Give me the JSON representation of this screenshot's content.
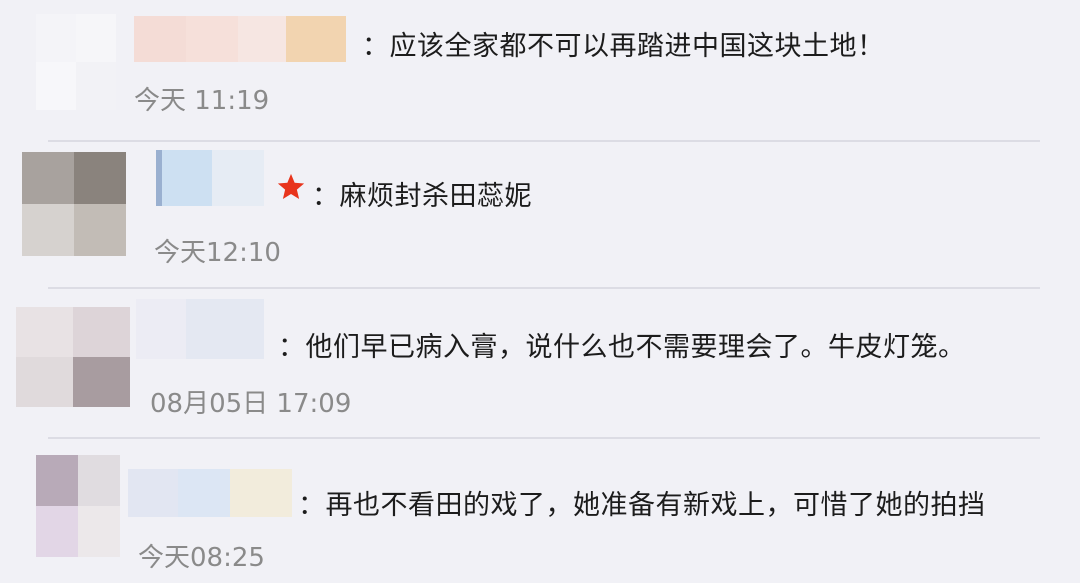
{
  "comments": [
    {
      "text": "：应该全家都不可以再踏进中国这块土地！",
      "time": "今天 11:19"
    },
    {
      "text": "：麻烦封杀田蕊妮",
      "time": "今天12:10",
      "badge_icon": "red-star-icon",
      "badge_color": "#e8341c"
    },
    {
      "text": "：他们早已病入膏，说什么也不需要理会了。牛皮灯笼。",
      "time": "08月05日 17:09"
    },
    {
      "text": "：再也不看田的戏了，她准备有新戏上，可惜了她的拍挡",
      "time": "今天08:25"
    }
  ]
}
